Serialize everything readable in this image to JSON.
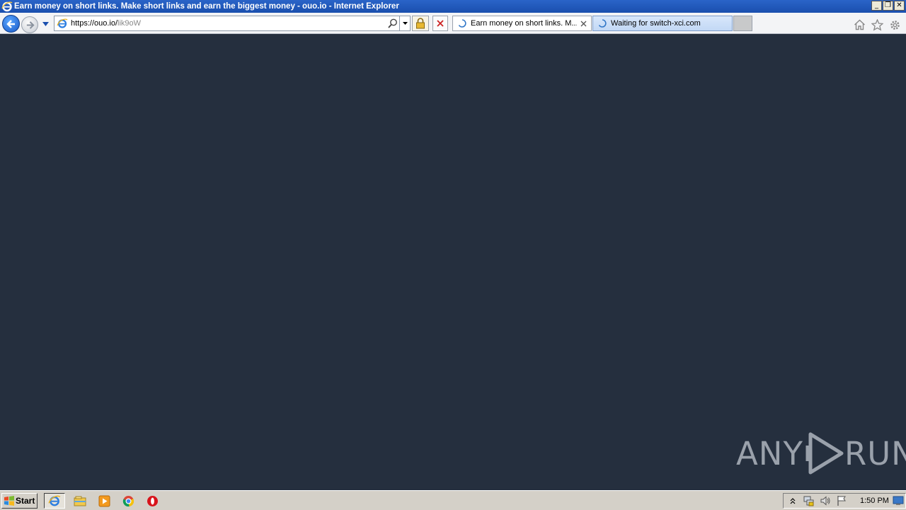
{
  "window": {
    "title": "Earn money on short links. Make short links and earn the biggest money - ouo.io - Internet Explorer",
    "controls": [
      "minimize",
      "restore",
      "close"
    ]
  },
  "address_bar": {
    "url_host": "https://ouo.io/",
    "url_path": "lik9oW"
  },
  "tabs": [
    {
      "label": "Earn money on short links. M...",
      "active": true,
      "loading": true
    },
    {
      "label": "Waiting for switch-xci.com",
      "active": false,
      "loading": true
    }
  ],
  "right_icons": [
    "home-icon",
    "favorites-star-icon",
    "settings-gear-icon"
  ],
  "watermark": {
    "left": "ANY",
    "right": "RUN"
  },
  "taskbar": {
    "start_label": "Start",
    "pinned": [
      "internet-explorer-icon",
      "file-explorer-icon",
      "media-player-icon",
      "chrome-icon",
      "opera-icon"
    ],
    "clock": "1:50 PM"
  },
  "colors": {
    "content_bg": "#252f3e",
    "title_bar": "#1f58bb"
  }
}
